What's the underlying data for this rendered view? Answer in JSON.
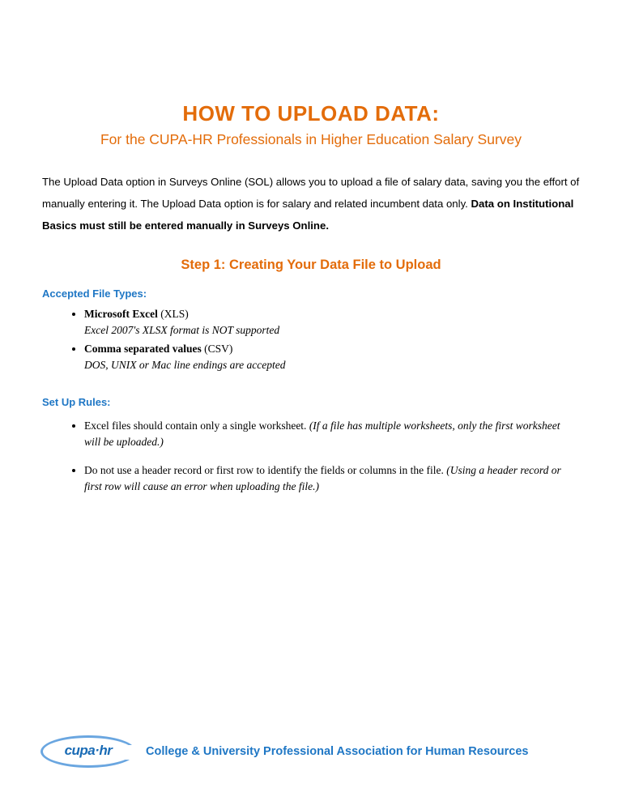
{
  "title": "HOW TO UPLOAD DATA:",
  "subtitle": "For the CUPA-HR Professionals in Higher Education Salary Survey",
  "intro": {
    "part1": "The Upload Data option in Surveys Online (SOL) allows you to upload a file of salary data, saving you the effort of manually entering it. The Upload Data option is for salary and related incumbent data only. ",
    "bold": "Data on Institutional Basics must still be entered manually in Surveys Online."
  },
  "step1": {
    "title": "Step 1: Creating Your Data File to Upload",
    "fileTypesLabel": "Accepted File Types:",
    "fileTypes": [
      {
        "name": "Microsoft Excel",
        "paren": " (XLS)",
        "note": "Excel 2007's XLSX format is NOT supported"
      },
      {
        "name": "Comma separated values",
        "paren": " (CSV)",
        "note": "DOS, UNIX or Mac line endings are accepted"
      }
    ],
    "rulesLabel": "Set Up Rules:",
    "rules": [
      {
        "text": "Excel files should contain only a single worksheet. ",
        "note": "(If a file has multiple worksheets, only the first worksheet will be uploaded.)"
      },
      {
        "text": "Do not use a header record or first row to identify the fields or columns in the file. ",
        "note": "(Using a header record or first row will cause an error when uploading the file.)"
      }
    ]
  },
  "footer": {
    "logoText": "cupa·hr",
    "tagline": "College & University Professional Association for Human Resources"
  }
}
